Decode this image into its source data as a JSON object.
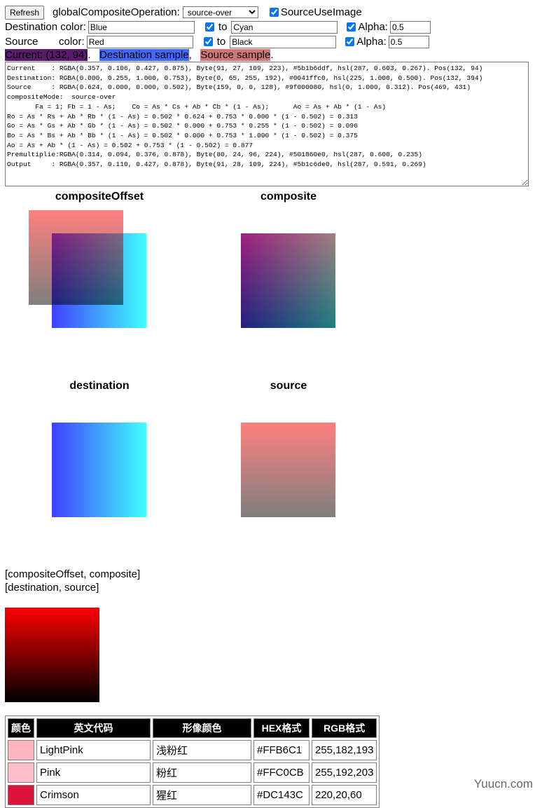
{
  "controls": {
    "refresh_label": "Refresh",
    "op_label": "globalCompositeOperation:",
    "op_value": "source-over",
    "source_use_image_label": "SourceUseImage",
    "source_use_image_checked": true,
    "destination": {
      "label": "Destination color:",
      "color": "Blue",
      "to_checked": true,
      "to_label": "to",
      "to_color": "Cyan",
      "alpha_checked": true,
      "alpha_label": "Alpha:",
      "alpha": "0.5"
    },
    "source": {
      "label_a": "Source",
      "label_b": "color:",
      "color": "Red",
      "to_checked": true,
      "to_label": "to",
      "to_color": "Black",
      "alpha_checked": true,
      "alpha_label": "Alpha:",
      "alpha": "0.5"
    }
  },
  "samples": {
    "current": "Current: (132, 94)",
    "current_color": "#5b1b6d",
    "dest": "Destination sample",
    "dest_color": "#4169ff",
    "src": "Source sample",
    "src_color": "#d47575"
  },
  "log_lines": [
    "Current    : RGBA(0.357, 0.106, 0.427, 0.875), Byte(91, 27, 109, 223), #5b1b6ddf, hsl(287, 0.603, 0.267). Pos(132, 94)",
    "Destination: RGBA(0.000, 0.255, 1.000, 0.753), Byte(0, 65, 255, 192), #0041ffc0, hsl(225, 1.000, 0.500). Pos(132, 394)",
    "Source     : RGBA(0.624, 0.000, 0.000, 0.502), Byte(159, 0, 0, 128), #9f000080, hsl(0, 1.000, 0.312). Pos(469, 431)",
    "compositeMode:  source-over",
    "       Fa = 1; Fb = 1 - As;    Co = As * Cs + Ab * Cb * (1 - As);      Ao = As + Ab * (1 - As)",
    "Ro = As * Rs + Ab * Rb * (1 - As) = 0.502 * 0.624 + 0.753 * 0.000 * (1 - 0.502) = 0.313",
    "Go = As * Gs + Ab * Gb * (1 - As) = 0.502 * 0.000 + 0.753 * 0.255 * (1 - 0.502) = 0.096",
    "Bo = As * Bs + Ab * Bb * (1 - As) = 0.502 * 0.000 + 0.753 * 1.000 * (1 - 0.502) = 0.375",
    "Ao = As + Ab * (1 - As) = 0.502 + 0.753 * (1 - 0.502) = 0.877",
    "Premultiplie:RGBA(0.314, 0.094, 0.376, 0.878), Byte(80, 24, 96, 224), #501860e0, hsl(287, 0.600, 0.235)",
    "Output     : RGBA(0.357, 0.110, 0.427, 0.878), Byte(91, 28, 109, 224), #5b1c6de0, hsl(287, 0.591, 0.269)"
  ],
  "canvases": {
    "composite_offset": "compositeOffset",
    "composite": "composite",
    "destination": "destination",
    "source": "source"
  },
  "layout_text": {
    "line1": "[compositeOffset, composite]",
    "line2": "[destination, source]"
  },
  "table": {
    "headers": [
      "颜色",
      "英文代码",
      "形像颜色",
      "HEX格式",
      "RGB格式"
    ],
    "rows": [
      {
        "swatch": "#FFB6C1",
        "name": "LightPink",
        "cn": "浅粉红",
        "hex": "#FFB6C1",
        "rgb": "255,182,193"
      },
      {
        "swatch": "#FFC0CB",
        "name": "Pink",
        "cn": "粉红",
        "hex": "#FFC0CB",
        "rgb": "255,192,203"
      },
      {
        "swatch": "#DC143C",
        "name": "Crimson",
        "cn": "猩红",
        "hex": "#DC143C",
        "rgb": "220,20,60"
      }
    ]
  },
  "watermark": "Yuucn.com"
}
